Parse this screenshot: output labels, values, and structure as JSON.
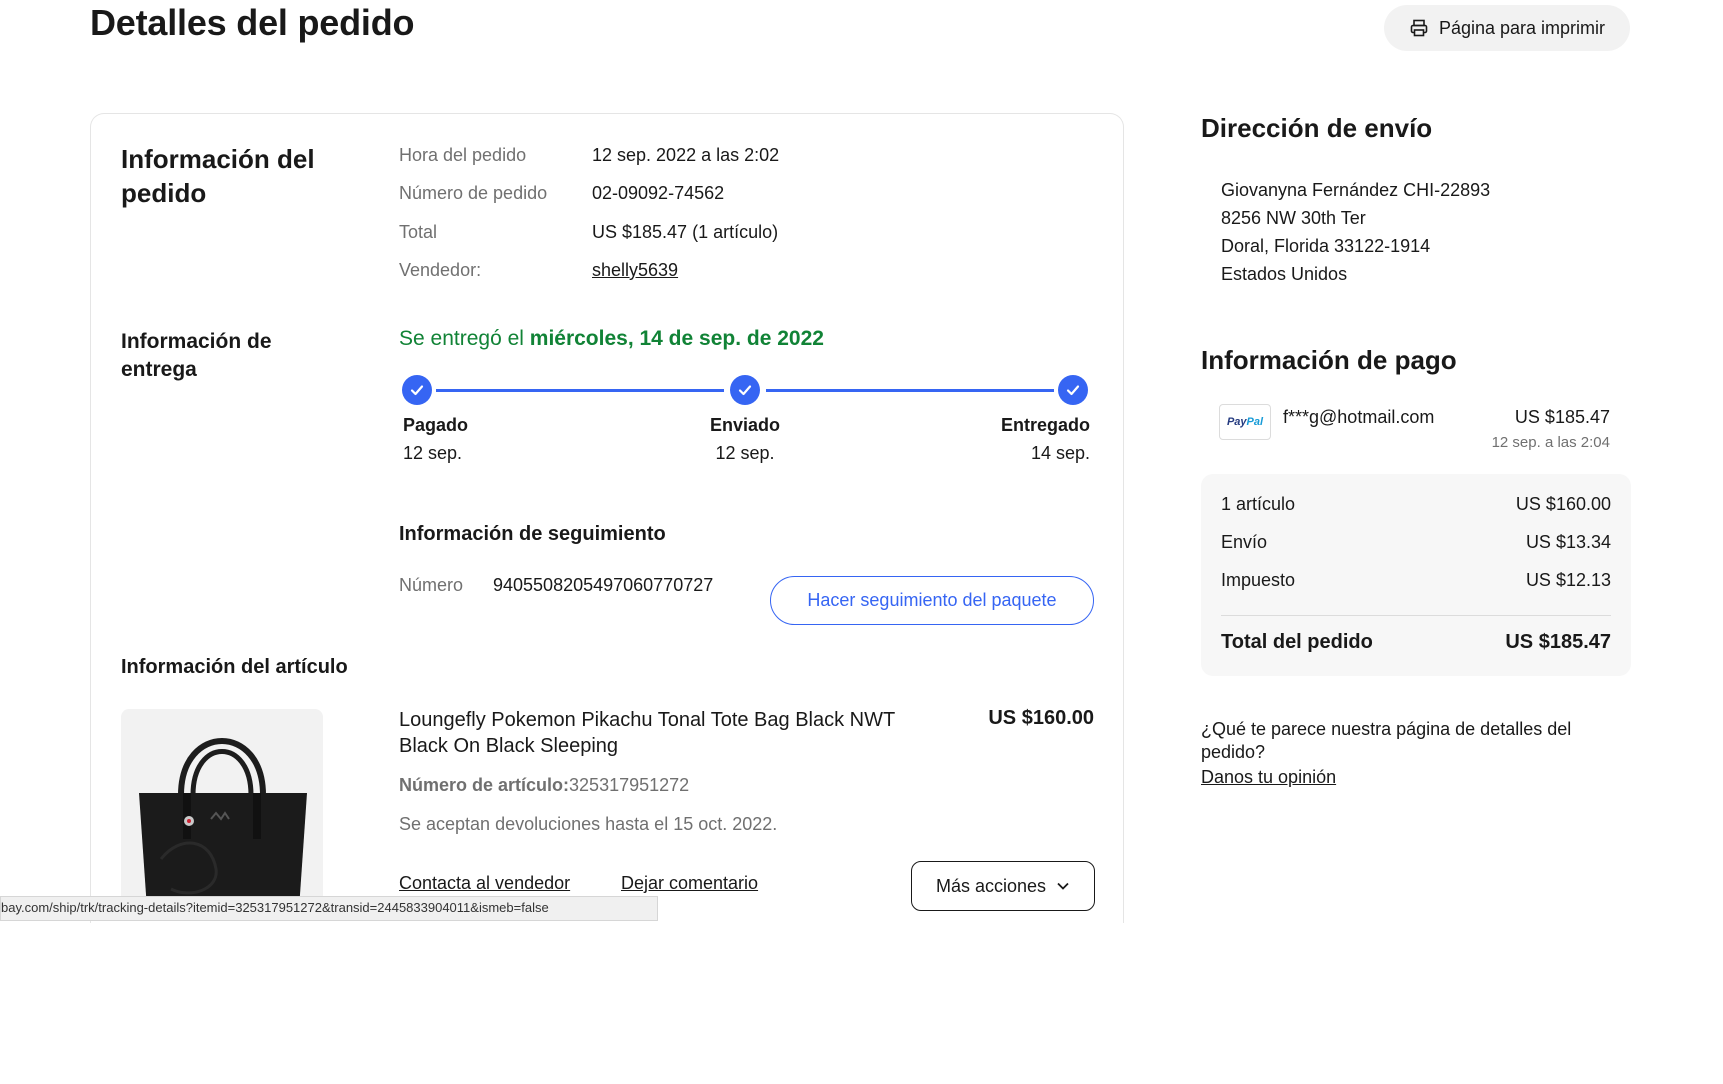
{
  "page": {
    "title": "Detalles del pedido",
    "print_label": "Página para imprimir"
  },
  "order_info": {
    "title": "Información del pedido",
    "rows": [
      {
        "label": "Hora del pedido",
        "value": "12 sep. 2022 a las 2:02"
      },
      {
        "label": "Número de pedido",
        "value": "02-09092-74562"
      },
      {
        "label": "Total",
        "value": "US $185.47 (1 artículo)"
      },
      {
        "label": "Vendedor:",
        "value": "shelly5639"
      }
    ]
  },
  "delivery": {
    "title": "Información de entrega",
    "status_prefix": "Se entregó el ",
    "status_date": "miércoles, 14 de sep. de 2022",
    "steps": [
      {
        "label": "Pagado",
        "date": "12 sep."
      },
      {
        "label": "Enviado",
        "date": "12 sep."
      },
      {
        "label": "Entregado",
        "date": "14 sep."
      }
    ],
    "tracking_title": "Información de seguimiento",
    "tracking_label": "Número",
    "tracking_number": "9405508205497060770727",
    "track_button": "Hacer seguimiento del paquete"
  },
  "item": {
    "section_title": "Información del artículo",
    "name": "Loungefly Pokemon Pikachu Tonal Tote Bag Black NWT Black On Black Sleeping",
    "price": "US $160.00",
    "number_label": "Número de artículo:",
    "number": "325317951272",
    "returns": "Se aceptan devoluciones hasta el 15 oct. 2022.",
    "contact_link": "Contacta al vendedor",
    "feedback_link": "Dejar comentario",
    "more_actions": "Más acciones"
  },
  "shipping": {
    "title": "Dirección de envío",
    "lines": [
      "Giovanyna Fernández CHI-22893",
      "8256 NW 30th Ter",
      "Doral, Florida 33122-1914",
      "Estados Unidos"
    ]
  },
  "payment": {
    "title": "Información de pago",
    "method_logo": "PayPal",
    "email": "f***g@hotmail.com",
    "amount": "US $185.47",
    "date": "12 sep. a las 2:04",
    "summary": [
      {
        "label": "1 artículo",
        "value": "US $160.00"
      },
      {
        "label": "Envío",
        "value": "US $13.34"
      },
      {
        "label": "Impuesto",
        "value": "US $12.13"
      }
    ],
    "total_label": "Total del pedido",
    "total_value": "US $185.47"
  },
  "feedback": {
    "question": "¿Qué te parece nuestra página de detalles del pedido?",
    "link": "Danos tu opinión"
  },
  "status_bar": {
    "url": "bay.com/ship/trk/tracking-details?itemid=325317951272&transid=2445833904011&ismeb=false"
  },
  "colors": {
    "accent": "#3665f3",
    "success": "#118336"
  }
}
